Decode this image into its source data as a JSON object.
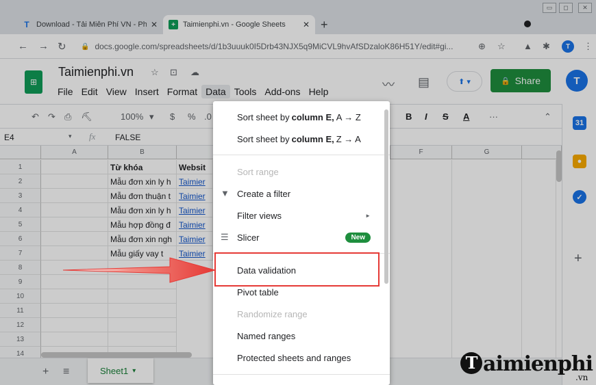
{
  "browser": {
    "tabs": [
      {
        "title": "Download - Tải Miễn Phí VN - Ph",
        "icon": "T"
      },
      {
        "title": "Taimienphi.vn - Google Sheets",
        "icon": "+"
      }
    ],
    "new_tab": "+",
    "window_buttons": [
      "▭",
      "◻",
      "✕"
    ],
    "url": "docs.google.com/spreadsheets/d/1b3uuuk0I5Drb43NJX5q9MiCVL9hvAfSDzaloK86H51Y/edit#gi...",
    "profile_initial": "T"
  },
  "sheets": {
    "title": "Taimienphi.vn",
    "menus": [
      "File",
      "Edit",
      "View",
      "Insert",
      "Format",
      "Data",
      "Tools",
      "Add-ons",
      "Help"
    ],
    "share_label": "Share",
    "account_initial": "T",
    "sheets_logo": "⊞"
  },
  "toolbar": {
    "zoom": "100%",
    "currency": "$",
    "percent": "%",
    "decimal": ".0",
    "bold": "B",
    "italic": "I",
    "strike": "S",
    "text_color": "A",
    "more": "···"
  },
  "formula_bar": {
    "cell_ref": "E4",
    "fx": "fx",
    "value": "FALSE"
  },
  "grid": {
    "columns": [
      "A",
      "B",
      "F",
      "G"
    ],
    "rows": [
      "1",
      "2",
      "3",
      "4",
      "5",
      "6",
      "7",
      "8",
      "9",
      "10",
      "11",
      "12",
      "13",
      "14"
    ],
    "b_col": [
      "Từ khóa",
      "Mẫu đơn xin ly h",
      "Mẫu đơn thuận t",
      "Mẫu đơn xin ly h",
      "Mẫu hợp đồng đ",
      "Mẫu đơn xin ngh",
      "Mẫu giấy vay t"
    ],
    "c_col": [
      "Websit",
      "Taimier",
      "Taimier",
      "Taimier",
      "Taimier",
      "Taimier",
      "Taimier"
    ]
  },
  "data_menu": {
    "sort_asc_prefix": "Sort sheet by",
    "sort_asc_col": "column E,",
    "sort_asc_suffix": "A → Z",
    "sort_desc_prefix": "Sort sheet by",
    "sort_desc_col": "column E,",
    "sort_desc_suffix": "Z → A",
    "sort_range": "Sort range",
    "create_filter": "Create a filter",
    "filter_views": "Filter views",
    "slicer": "Slicer",
    "new_badge": "New",
    "data_validation": "Data validation",
    "pivot_table": "Pivot table",
    "randomize_range": "Randomize range",
    "named_ranges": "Named ranges",
    "protected": "Protected sheets and ranges"
  },
  "sheet_tabs": {
    "add": "+",
    "list": "≡",
    "active": "Sheet1",
    "active_caret": "▾"
  },
  "watermark": {
    "initial": "T",
    "text": "aimienphi",
    "suffix": ".vn"
  },
  "colors": {
    "accent_green": "#1e8e3e",
    "highlight_red": "#e53935",
    "link_blue": "#1155cc"
  }
}
